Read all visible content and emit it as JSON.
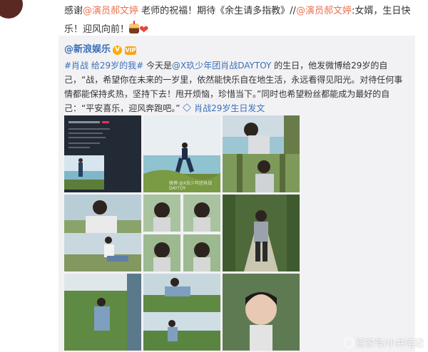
{
  "top_comment": {
    "prefix": "感谢",
    "mention1": "@演员郝文婷",
    "mid": " 老师的祝福！期待《余生请多指教》//",
    "mention2": "@演员郝文婷",
    "text": ":女婿，生日快乐！迎风向前！",
    "emojis": [
      "cake-emoji",
      "heart-emoji"
    ]
  },
  "repost": {
    "author": "@新浪娱乐",
    "badge": "V",
    "vip": "VIP",
    "hashtag": "#肖战 给29岁的我#",
    "t1": " 今天是",
    "mention": "@X玖少年团肖战DAYTOY",
    "t2": " 的生日，他发微博给29岁的自己，“战，希望你在未来的一岁里，依然能快乐自在地生活，永远看得见阳光。对待任何事情都能保持炙热，坚持下去！甩开烦恼，珍惜当下。”同时也希望粉丝都能成为最好的自己：“平安喜乐，迎风奔跑吧。”",
    "link": "肖战29岁生日发文"
  },
  "photos": {
    "count": 9,
    "small_watermark": "微博 @X玖少年团肖战DAYTOY"
  },
  "watermark": {
    "text": "百家号/小井笔记"
  },
  "colors": {
    "link_orange": "#eb7350",
    "link_blue": "#3b6fb6",
    "repost_bg": "#f2f2f5"
  }
}
